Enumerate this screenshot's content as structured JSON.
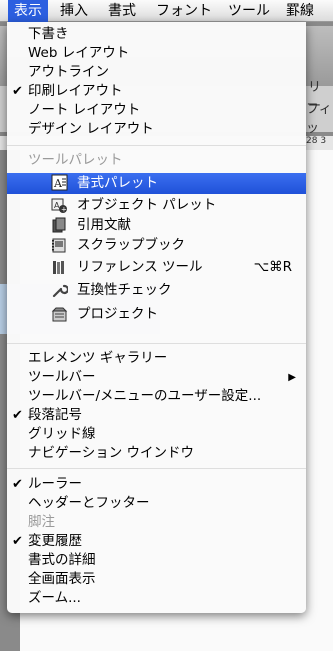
{
  "menubar": {
    "items": [
      "表示",
      "挿入",
      "書式",
      "フォント",
      "ツール",
      "罫線"
    ]
  },
  "background": {
    "peek_text_1": "リー",
    "peek_text_2": "フィッ",
    "peek_text_3": "28 3"
  },
  "menu": {
    "group1": [
      {
        "label": "下書き",
        "checked": false
      },
      {
        "label": "Web レイアウト",
        "checked": false
      },
      {
        "label": "アウトライン",
        "checked": false
      },
      {
        "label": "印刷レイアウト",
        "checked": true
      },
      {
        "label": "ノート レイアウト",
        "checked": false
      },
      {
        "label": "デザイン レイアウト",
        "checked": false
      }
    ],
    "palette_header": "ツールパレット",
    "palettes": [
      {
        "label": "書式パレット",
        "icon": "formatting-palette-icon"
      },
      {
        "label": "オブジェクト パレット",
        "icon": "object-palette-icon"
      },
      {
        "label": "引用文献",
        "icon": "citations-icon"
      },
      {
        "label": "スクラップブック",
        "icon": "scrapbook-icon"
      },
      {
        "label": "リファレンス ツール",
        "icon": "reference-tools-icon",
        "shortcut": "⌥⌘R"
      },
      {
        "label": "互換性チェック",
        "icon": "compatibility-wrench-icon"
      },
      {
        "label": "プロジェクト",
        "icon": "project-palette-icon"
      }
    ],
    "group3": [
      {
        "label": "エレメンツ ギャラリー",
        "checked": false
      },
      {
        "label": "ツールバー",
        "checked": false,
        "submenu": true
      },
      {
        "label": "ツールバー/メニューのユーザー設定...",
        "checked": false
      },
      {
        "label": "段落記号",
        "checked": true
      },
      {
        "label": "グリッド線",
        "checked": false
      },
      {
        "label": "ナビゲーション ウインドウ",
        "checked": false
      }
    ],
    "group4": [
      {
        "label": "ルーラー",
        "checked": true
      },
      {
        "label": "ヘッダーとフッター",
        "checked": false
      },
      {
        "label": "脚注",
        "checked": false,
        "disabled": true
      },
      {
        "label": "変更履歴",
        "checked": true
      },
      {
        "label": "書式の詳細",
        "checked": false
      },
      {
        "label": "全画面表示",
        "checked": false
      },
      {
        "label": "ズーム...",
        "checked": false
      }
    ],
    "check_glyph": "✔",
    "submenu_glyph": "▶",
    "highlight_color": "#2c5fe0"
  }
}
